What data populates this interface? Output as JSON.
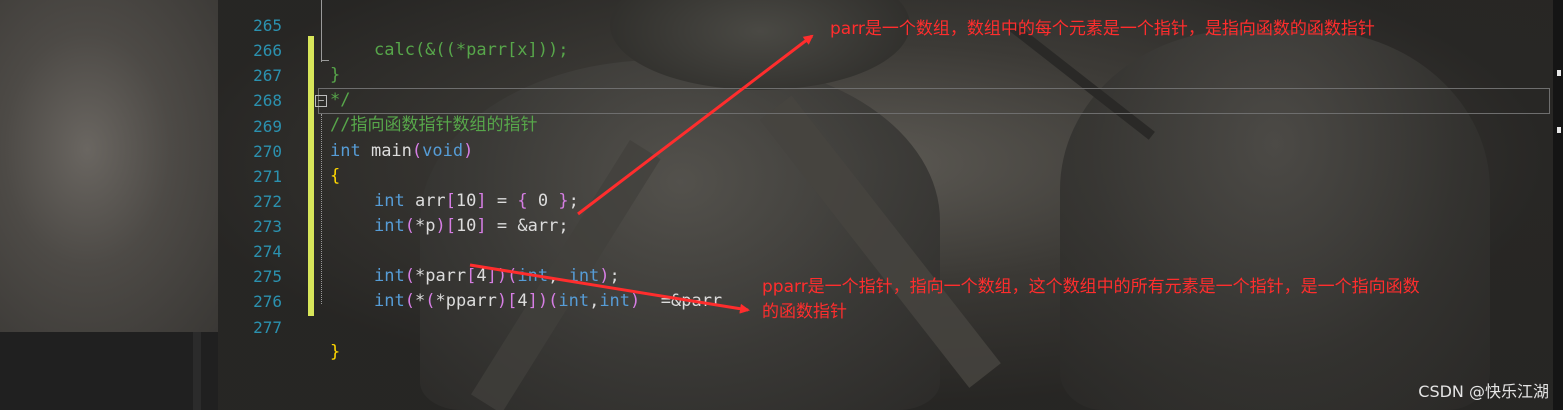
{
  "editor": {
    "lines": [
      {
        "num": "265",
        "text": "calc(&((*parr[x]));"
      },
      {
        "num": "266",
        "text": "}"
      },
      {
        "num": "267",
        "text": "*/"
      },
      {
        "num": "268",
        "text": "//指向函数指针数组的指针"
      },
      {
        "num": "269",
        "text": "int main(void)"
      },
      {
        "num": "270",
        "text": "{"
      },
      {
        "num": "271",
        "text": "int arr[10] = { 0 };"
      },
      {
        "num": "272",
        "text": "int(*p)[10] = &arr;"
      },
      {
        "num": "273",
        "text": ""
      },
      {
        "num": "274",
        "text": "int(*parr[4])(int, int);"
      },
      {
        "num": "275",
        "text": "int(*(*pparr)[4])(int,int)  =&parr"
      },
      {
        "num": "276",
        "text": ""
      },
      {
        "num": "277",
        "text": "}"
      }
    ]
  },
  "annotations": {
    "parr_note": "parr是一个数组，数组中的每个元素是一个指针，是指向函数的函数指针",
    "pparr_note_line1": "pparr是一个指针，指向一个数组，这个数组中的所有元素是一个指针，是一个指向函数",
    "pparr_note_line2": "的函数指针"
  },
  "colors": {
    "annotation": "#ff2d2d",
    "keyword": "#569cd6",
    "comment": "#57a64a",
    "line_number": "#2b91af",
    "change_bar": "#d8e65a"
  },
  "watermark": "CSDN @快乐江湖"
}
